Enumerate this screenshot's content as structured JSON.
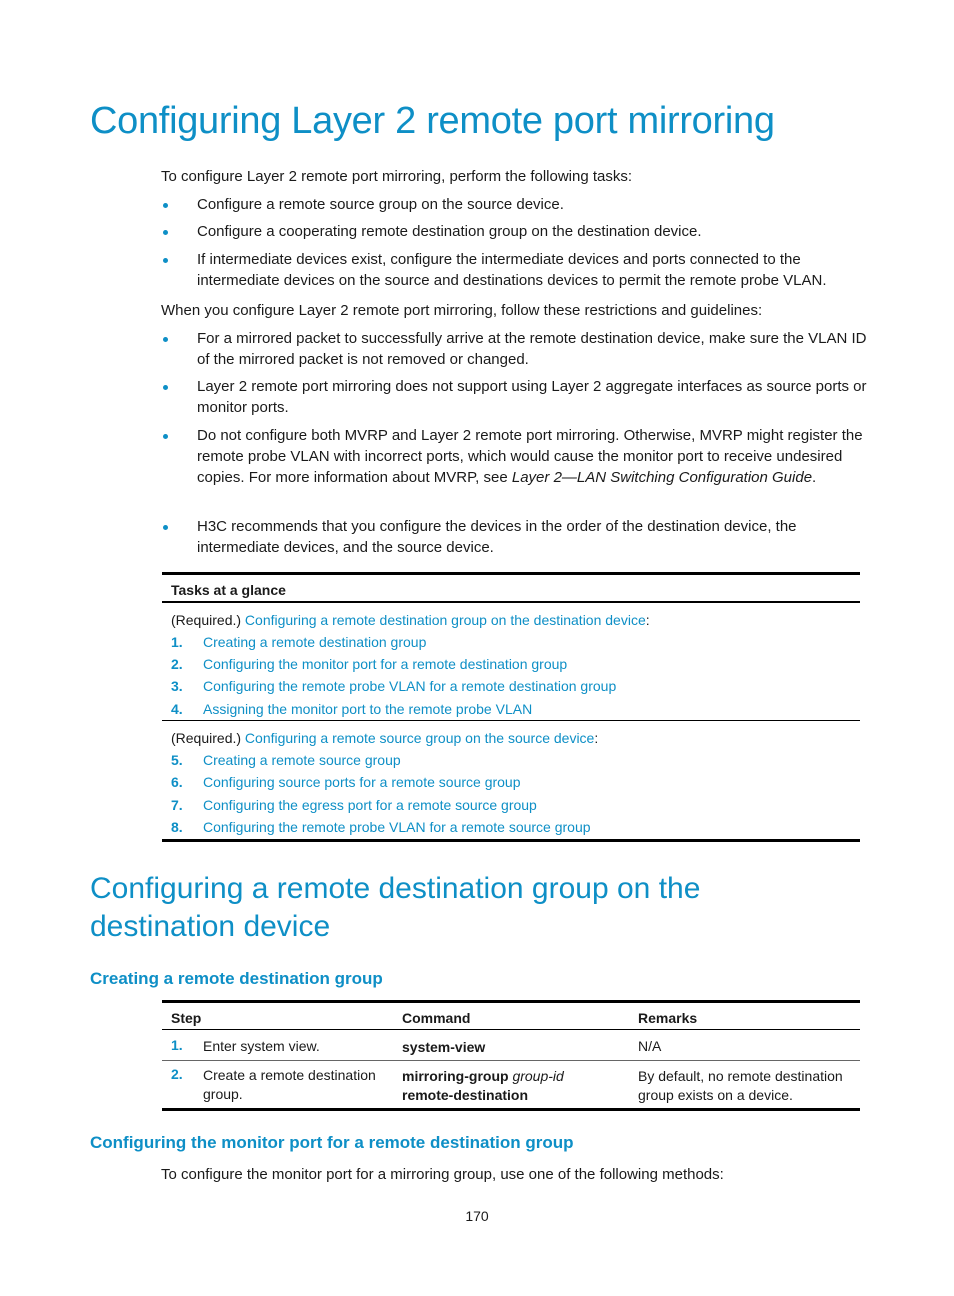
{
  "page_title": "Configuring Layer 2 remote port mirroring",
  "intro": "To configure Layer 2 remote port mirroring, perform the following tasks:",
  "tasks_bullets": [
    "Configure a remote source group on the source device.",
    "Configure a cooperating remote destination group on the destination device.",
    "If intermediate devices exist, configure the intermediate devices and ports connected to the intermediate devices on the source and destinations devices to permit the remote probe VLAN."
  ],
  "restrictions_intro": "When you configure Layer 2 remote port mirroring, follow these restrictions and guidelines:",
  "restrictions": [
    {
      "text": "For a mirrored packet to successfully arrive at the remote destination device, make sure the VLAN ID of the mirrored packet is not removed or changed."
    },
    {
      "text": "Layer 2 remote port mirroring does not support using Layer 2 aggregate interfaces as source ports or monitor ports."
    },
    {
      "text_before": "Do not configure both MVRP and Layer 2 remote port mirroring. Otherwise, MVRP might register the remote probe VLAN with incorrect ports, which would cause the monitor port to receive undesired copies. For more information about MVRP, see ",
      "italic": "Layer 2—LAN Switching Configuration Guide",
      "text_after": "."
    },
    {
      "text": "H3C recommends that you configure the devices in the order of the destination device, the intermediate devices, and the source device."
    }
  ],
  "glance_table": {
    "header": "Tasks at a glance",
    "groups": [
      {
        "required_label": "(Required.)",
        "link": "Configuring a remote destination group on the destination device",
        "suffix": ":",
        "items": [
          {
            "num": "1.",
            "label": "Creating a remote destination group"
          },
          {
            "num": "2.",
            "label": "Configuring the monitor port for a remote destination group"
          },
          {
            "num": "3.",
            "label": "Configuring the remote probe VLAN for a remote destination group"
          },
          {
            "num": "4.",
            "label": "Assigning the monitor port to the remote probe VLAN"
          }
        ]
      },
      {
        "required_label": "(Required.)",
        "link": "Configuring a remote source group on the source device",
        "suffix": ":",
        "items": [
          {
            "num": "5.",
            "label": "Creating a remote source group"
          },
          {
            "num": "6.",
            "label": "Configuring source ports for a remote source group"
          },
          {
            "num": "7.",
            "label": "Configuring the egress port for a remote source group"
          },
          {
            "num": "8.",
            "label": "Configuring the remote probe VLAN for a remote source group"
          }
        ]
      }
    ]
  },
  "section2_title": "Configuring a remote destination group on the destination device",
  "subsection1_title": "Creating a remote destination group",
  "step_table": {
    "headers": [
      "Step",
      "Command",
      "Remarks"
    ],
    "rows": [
      {
        "num": "1.",
        "step": "Enter system view.",
        "cmd_bold": "system-view",
        "cmd_italic": "",
        "cmd_bold2": "",
        "remarks": "N/A"
      },
      {
        "num": "2.",
        "step": "Create a remote destination group.",
        "cmd_bold": "mirroring-group",
        "cmd_italic": "group-id",
        "cmd_bold2": "remote-destination",
        "remarks": "By default, no remote destination group exists on a device."
      }
    ]
  },
  "subsection2_title": "Configuring the monitor port for a remote destination group",
  "subsection2_intro": "To configure the monitor port for a mirroring group, use one of the following methods:",
  "page_number": "170"
}
